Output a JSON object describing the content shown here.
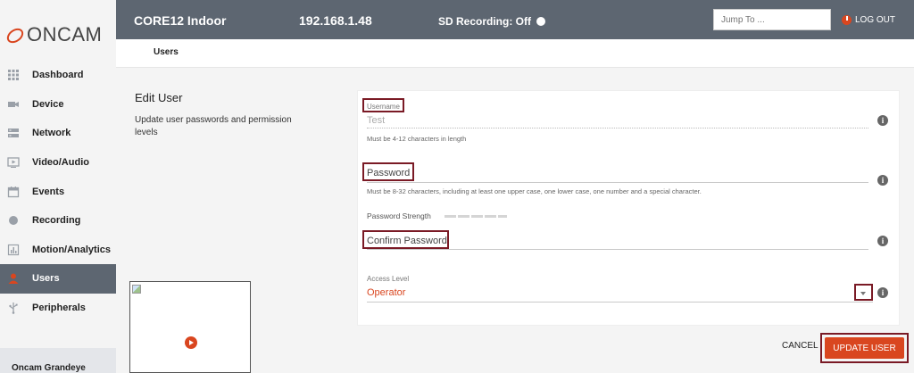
{
  "brand": {
    "logo_text": "ONCAM",
    "accent": "#d9461f",
    "header_bg": "#5d6671"
  },
  "header": {
    "device_name": "CORE12 Indoor",
    "ip": "192.168.1.48",
    "sd_recording": "SD Recording: Off",
    "jump_placeholder": "Jump To ...",
    "logout": "LOG OUT"
  },
  "subheader": {
    "title": "Users"
  },
  "sidebar": {
    "items": [
      {
        "label": "Dashboard",
        "icon": "grid-icon"
      },
      {
        "label": "Device",
        "icon": "camera-icon"
      },
      {
        "label": "Network",
        "icon": "server-icon"
      },
      {
        "label": "Video/Audio",
        "icon": "video-icon"
      },
      {
        "label": "Events",
        "icon": "calendar-icon"
      },
      {
        "label": "Recording",
        "icon": "record-icon"
      },
      {
        "label": "Motion/Analytics",
        "icon": "chart-icon"
      },
      {
        "label": "Users",
        "icon": "user-icon",
        "active": true
      },
      {
        "label": "Peripherals",
        "icon": "usb-icon"
      }
    ],
    "footer": "Oncam Grandeye"
  },
  "edit": {
    "title": "Edit User",
    "description": "Update user passwords and permission levels"
  },
  "form": {
    "username_label": "Username",
    "username_value": "Test",
    "username_hint": "Must be 4-12 characters in length",
    "password_label": "Password",
    "password_hint": "Must be 8-32 characters, including at least one upper case, one lower case, one number and a special character.",
    "strength_label": "Password Strength",
    "confirm_label": "Confirm Password",
    "access_label": "Access Level",
    "access_value": "Operator"
  },
  "actions": {
    "cancel": "CANCEL",
    "update": "UPDATE USER"
  }
}
